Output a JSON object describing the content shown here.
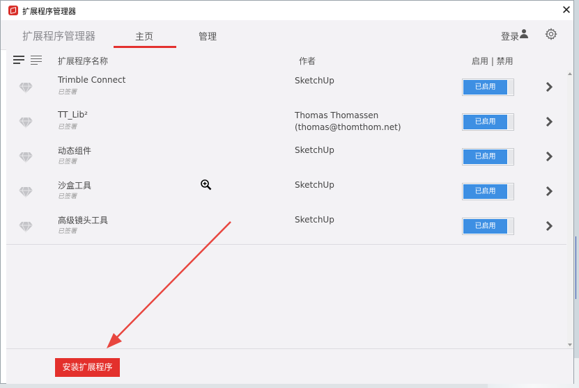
{
  "window": {
    "title": "扩展程序管理器",
    "close_glyph": "✕"
  },
  "nav": {
    "title": "扩展程序管理器",
    "tabs": [
      {
        "label": "主页",
        "active": true
      },
      {
        "label": "管理",
        "active": false
      }
    ],
    "login_label": "登录"
  },
  "columns": {
    "name": "扩展程序名称",
    "author": "作者",
    "toggle": "启用 | 禁用"
  },
  "extensions": [
    {
      "name": "Trimble Connect",
      "status": "已签署",
      "author": "SketchUp",
      "author_email": "",
      "toggle_label": "已启用"
    },
    {
      "name": "TT_Lib²",
      "status": "已签署",
      "author": "Thomas Thomassen",
      "author_email": "(thomas@thomthom.net)",
      "toggle_label": "已启用"
    },
    {
      "name": "动态组件",
      "status": "已签署",
      "author": "SketchUp",
      "author_email": "",
      "toggle_label": "已启用"
    },
    {
      "name": "沙盒工具",
      "status": "已签署",
      "author": "SketchUp",
      "author_email": "",
      "toggle_label": "已启用"
    },
    {
      "name": "高级镜头工具",
      "status": "已签署",
      "author": "SketchUp",
      "author_email": "",
      "toggle_label": "已启用"
    }
  ],
  "footer": {
    "install_label": "安装扩展程序"
  },
  "icons": {
    "app": "sketchup-app-icon",
    "user": "user-icon",
    "gear": "gear-icon",
    "row": "gem-icon",
    "chevron": "chevron-right-icon"
  },
  "colors": {
    "accent_red": "#e3312f",
    "toggle_blue": "#3d8fe3",
    "annotation_arrow": "#e8463f"
  }
}
